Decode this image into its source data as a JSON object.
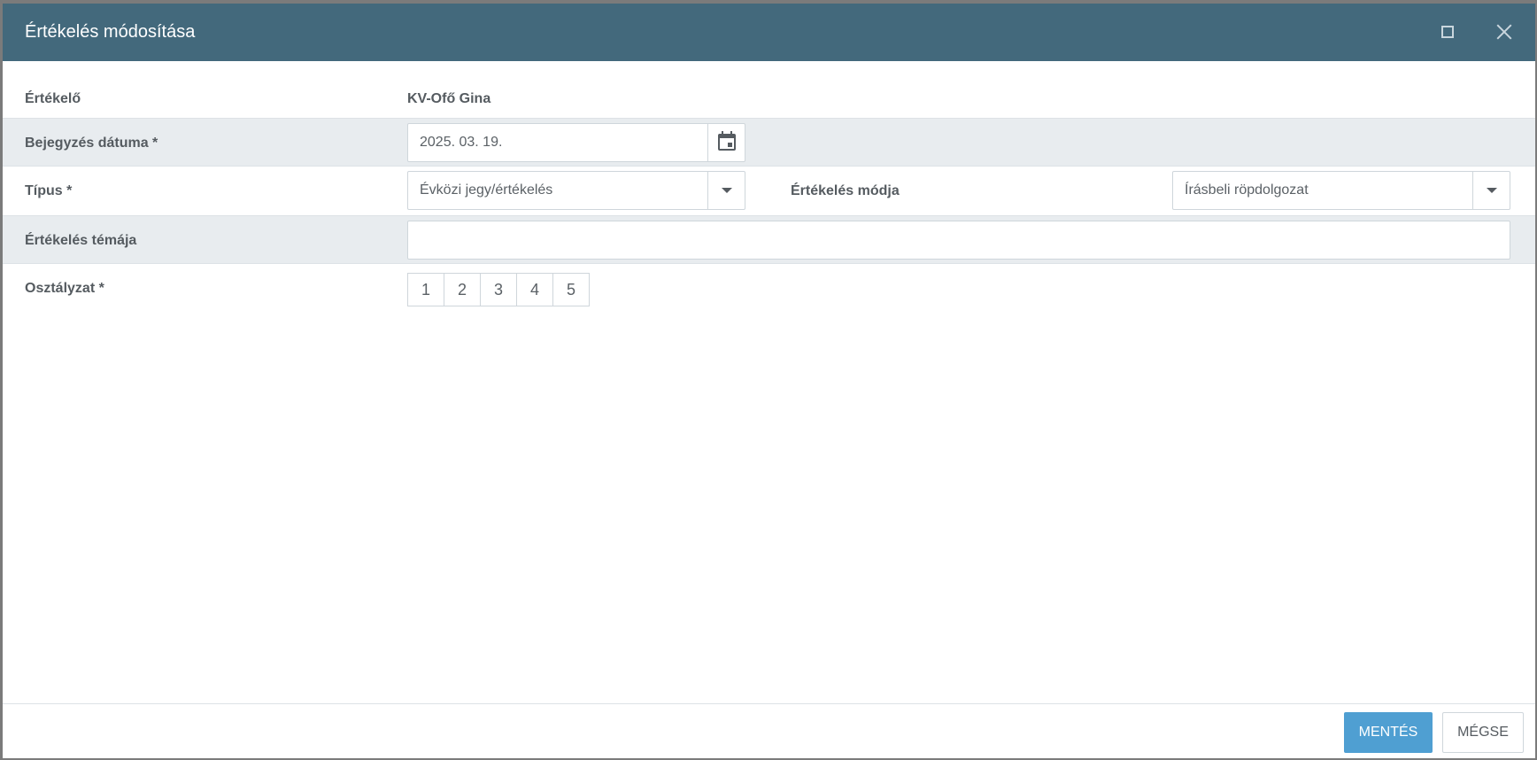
{
  "dialog": {
    "title": "Értékelés módosítása",
    "maximize_icon": "maximize-icon",
    "close_icon": "close-icon"
  },
  "form": {
    "evaluator_label": "Értékelő",
    "evaluator_value": "KV-Ofő Gina",
    "date_label": "Bejegyzés dátuma *",
    "date_value": "2025. 03. 19.",
    "type_label": "Típus *",
    "type_value": "Évközi jegy/értékelés",
    "mode_label": "Értékelés módja",
    "mode_value": "Írásbeli röpdolgozat",
    "topic_label": "Értékelés témája",
    "topic_value": "",
    "grade_label": "Osztályzat *",
    "grades": [
      "1",
      "2",
      "3",
      "4",
      "5"
    ]
  },
  "footer": {
    "save_label": "MENTÉS",
    "cancel_label": "MÉGSE"
  },
  "colors": {
    "titlebar": "#43697c",
    "save_button": "#4f9fd2",
    "row_alt": "#e8ecef"
  }
}
